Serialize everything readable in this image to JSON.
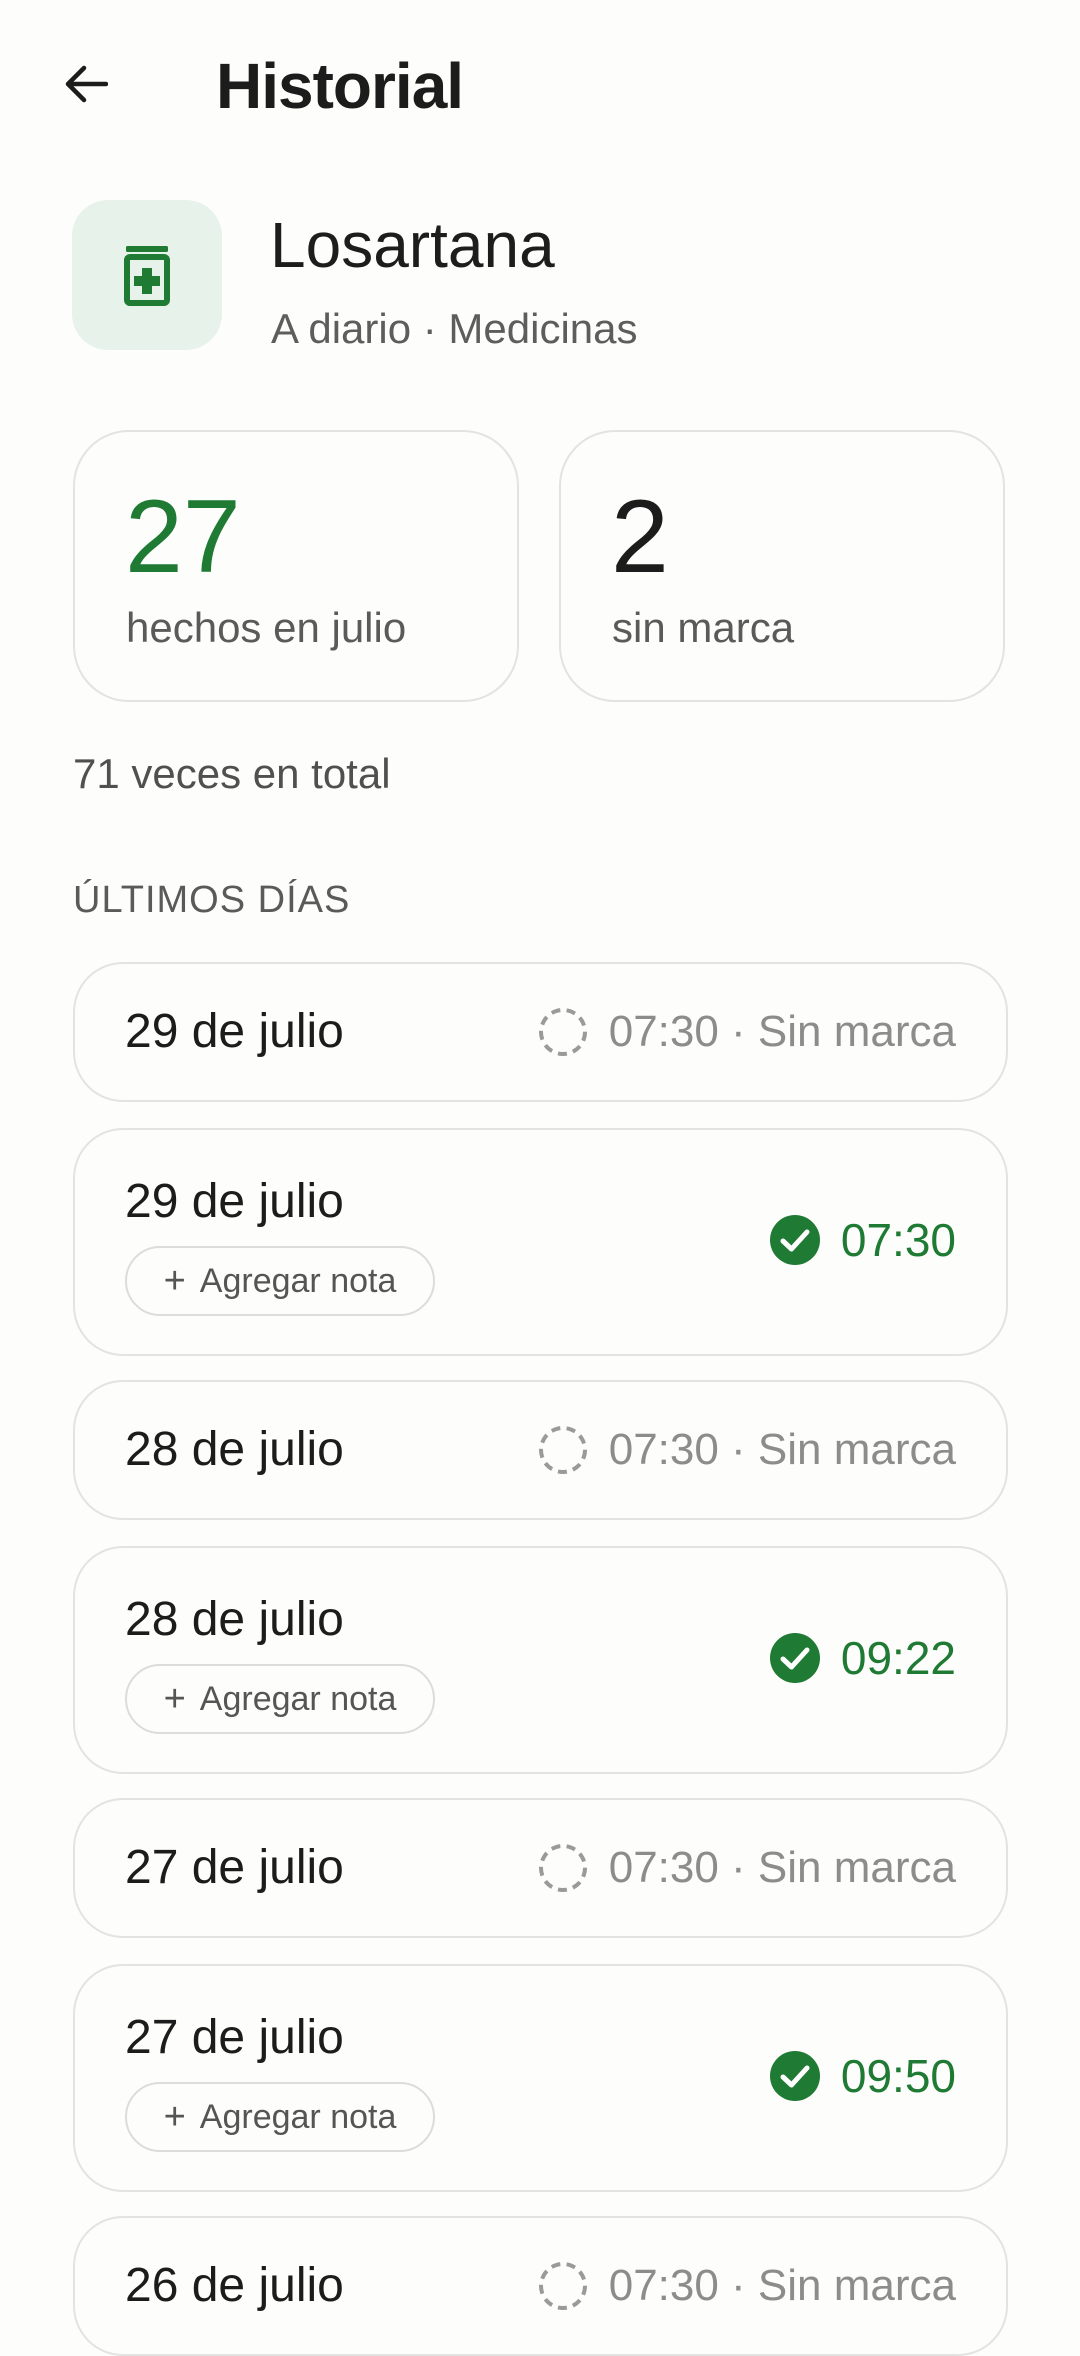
{
  "header": {
    "title": "Historial"
  },
  "medication": {
    "name": "Losartana",
    "subtitle": "A diario · Medicinas",
    "icon": "pill-bottle-icon",
    "accent": "#1f7a34"
  },
  "stats": {
    "done": {
      "value": "27",
      "label": "hechos en julio"
    },
    "unmarked": {
      "value": "2",
      "label": "sin marca"
    }
  },
  "total_text": "71 veces en total",
  "section_heading": "ÚLTIMOS DÍAS",
  "days": [
    {
      "date": "29 de julio",
      "status": "unmarked",
      "status_text": "07:30 · Sin marca"
    },
    {
      "date": "29 de julio",
      "status": "done",
      "status_text": "07:30",
      "note_label": "Agregar nota"
    },
    {
      "date": "28 de julio",
      "status": "unmarked",
      "status_text": "07:30 · Sin marca"
    },
    {
      "date": "28 de julio",
      "status": "done",
      "status_text": "09:22",
      "note_label": "Agregar nota"
    },
    {
      "date": "27 de julio",
      "status": "unmarked",
      "status_text": "07:30 · Sin marca"
    },
    {
      "date": "27 de julio",
      "status": "done",
      "status_text": "09:50",
      "note_label": "Agregar nota"
    },
    {
      "date": "26 de julio",
      "status": "unmarked",
      "status_text": "07:30 · Sin marca"
    }
  ]
}
